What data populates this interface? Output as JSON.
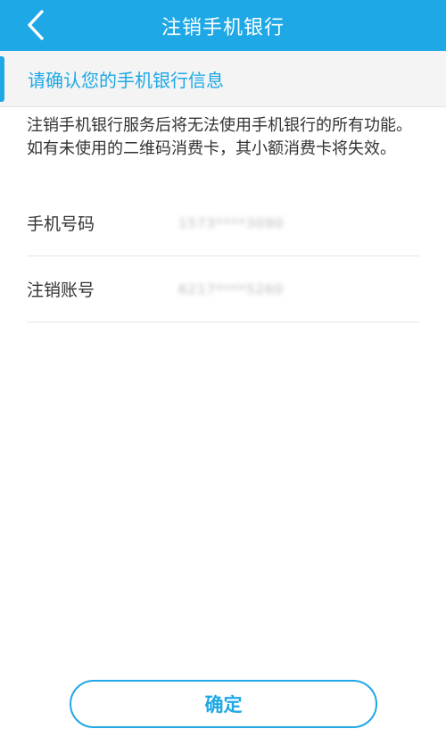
{
  "header": {
    "title": "注销手机银行",
    "back_icon": "chevron-left-icon"
  },
  "section": {
    "title": "请确认您的手机银行信息"
  },
  "notice": "注销手机银行服务后将无法使用手机银行的所有功能。如有未使用的二维码消费卡，其小额消费卡将失效。",
  "fields": [
    {
      "label": "手机号码",
      "value": "1573****3090"
    },
    {
      "label": "注销账号",
      "value": "6217****5260"
    }
  ],
  "confirm_label": "确定",
  "colors": {
    "accent": "#1ea8e6",
    "section_bg": "#f4f4f4",
    "text": "#333333"
  }
}
